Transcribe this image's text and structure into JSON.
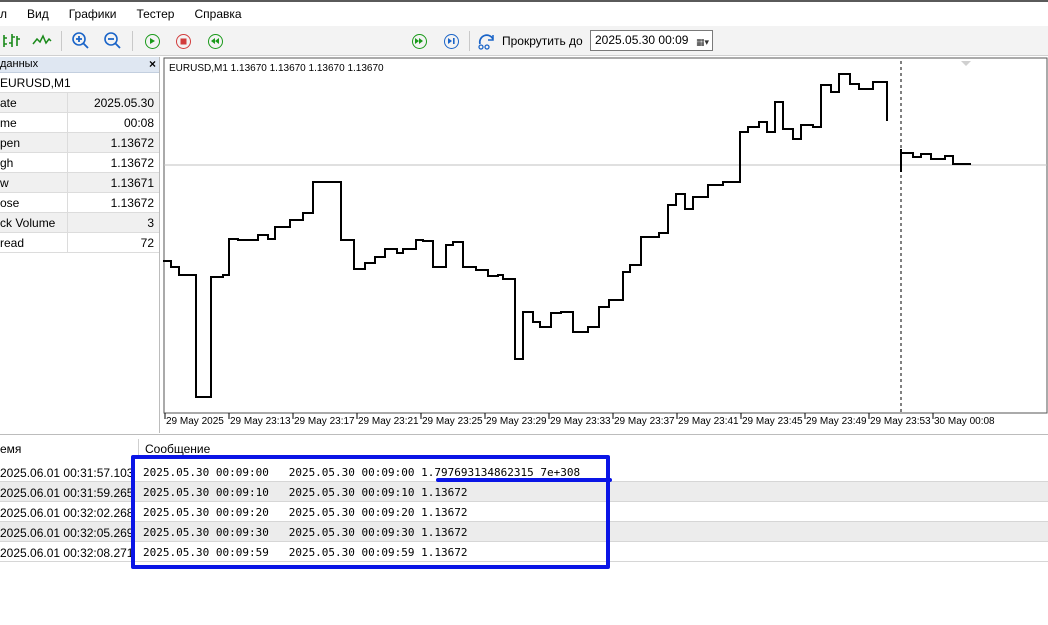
{
  "menu": [
    "л",
    "Вид",
    "Графики",
    "Тестер",
    "Справка"
  ],
  "toolbar": {
    "scroll_label": "Прокрутить до",
    "scroll_date": "2025.05.30 00:09",
    "tester_progress": 0.0
  },
  "data_window": {
    "title": "данных",
    "symbol": "EURUSD,M1",
    "rows": [
      {
        "key": "ate",
        "value": "2025.05.30"
      },
      {
        "key": "me",
        "value": "00:08"
      },
      {
        "key": "pen",
        "value": "1.13672"
      },
      {
        "key": "gh",
        "value": "1.13672"
      },
      {
        "key": "w",
        "value": "1.13671"
      },
      {
        "key": "ose",
        "value": "1.13672"
      },
      {
        "key": "ck Volume",
        "value": "3"
      },
      {
        "key": "read",
        "value": "72"
      }
    ]
  },
  "chart": {
    "title": "EURUSD,M1  1.13670 1.13670 1.13670 1.13670",
    "x_labels": [
      "29 May 2025",
      "29 May 23:13",
      "29 May 23:17",
      "29 May 23:21",
      "29 May 23:25",
      "29 May 23:29",
      "29 May 23:33",
      "29 May 23:37",
      "29 May 23:41",
      "29 May 23:45",
      "29 May 23:49",
      "29 May 23:53",
      "30 May 00:08"
    ],
    "line_color": "#000000"
  },
  "journal": {
    "col_time": "емя",
    "col_message": "Сообщение",
    "rows": [
      {
        "time": "2025.06.01 00:31:57.103",
        "message": "2025.05.30 00:09:00   2025.05.30 00:09:00 1.797693134862315 7e+308"
      },
      {
        "time": "2025.06.01 00:31:59.265",
        "message": "2025.05.30 00:09:10   2025.05.30 00:09:10 1.13672"
      },
      {
        "time": "2025.06.01 00:32:02.268",
        "message": "2025.05.30 00:09:20   2025.05.30 00:09:20 1.13672"
      },
      {
        "time": "2025.06.01 00:32:05.269",
        "message": "2025.05.30 00:09:30   2025.05.30 00:09:30 1.13672"
      },
      {
        "time": "2025.06.01 00:32:08.271",
        "message": "2025.05.30 00:09:59   2025.05.30 00:09:59 1.13672"
      }
    ],
    "highlight_color": "#0a15e6"
  }
}
